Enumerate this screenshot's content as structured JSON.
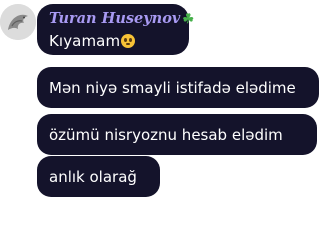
{
  "chat": {
    "sender_name": "Turan Huseynov",
    "sender_badge_icon": "shamrock-icon",
    "avatar_icon": "dragon-avatar-icon",
    "messages": [
      {
        "text": "Kıyamam",
        "emoji": "pleading-face-emoji"
      },
      {
        "text": "Mən niyə smayli istifadə elədime"
      },
      {
        "text": "özümü nisryoznu hesab elədim"
      },
      {
        "text": "anlık olarağ"
      }
    ]
  },
  "colors": {
    "bubble_background": "#14132b",
    "sender_name_color": "#a89af2",
    "message_text_color": "#ffffff"
  }
}
